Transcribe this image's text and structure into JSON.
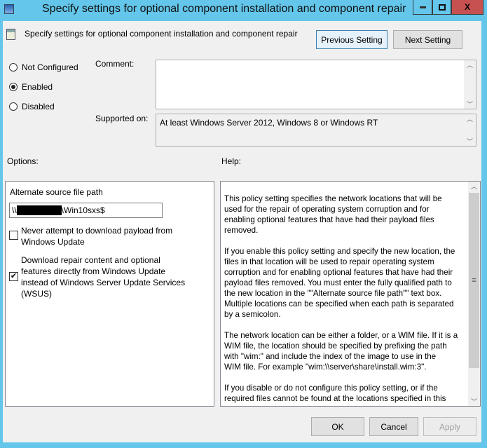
{
  "window": {
    "title": "Specify settings for optional component installation and component repair",
    "minimize": "‒",
    "maximize": "□",
    "close": "X",
    "frame_color": "#63c6ea",
    "close_color": "#c75050"
  },
  "header": {
    "setting_name": "Specify settings for optional component installation and component repair",
    "previous_label": "Previous Setting",
    "next_label": "Next Setting"
  },
  "state": {
    "options": [
      "Not Configured",
      "Enabled",
      "Disabled"
    ],
    "selected": "Enabled"
  },
  "comment": {
    "label": "Comment:",
    "value": ""
  },
  "supported": {
    "label": "Supported on:",
    "value": "At least Windows Server 2012, Windows 8 or Windows RT"
  },
  "options_label": "Options:",
  "help_label": "Help:",
  "options": {
    "path_label": "Alternate source file path",
    "path_prefix": "\\\\",
    "path_suffix": "\\Win10sxs$",
    "never_download": {
      "lines": [
        "Never attempt to download payload from",
        "Windows Update"
      ],
      "checked": false
    },
    "download_wu": {
      "lines": [
        "Download repair content and optional",
        "features directly from Windows Update",
        "instead of Windows Server Update Services",
        "(WSUS)"
      ],
      "checked": true
    }
  },
  "help": {
    "paragraphs": [
      [
        "This policy setting specifies the network locations that will be",
        "used for the repair of operating system corruption and for",
        "enabling optional features that have had their payload files",
        "removed."
      ],
      [
        "If you enable this policy setting and specify the new location, the",
        "files in that location will be used to repair operating system",
        "corruption and for enabling optional features that have had their",
        "payload files removed. You must enter the fully qualified path to",
        "the new location in the \"\"Alternate source file path\"\" text box.",
        "Multiple locations can be specified when each path is separated",
        "by a semicolon."
      ],
      [
        "The network location can be either a folder, or a WIM file. If it is a",
        "WIM file, the location should be specified by prefixing the path",
        "with \"wim:\" and include the index of the image to use in the",
        "WIM file. For example \"wim:\\\\server\\share\\install.wim:3\"."
      ],
      [
        "If you disable or do not configure this policy setting, or if the",
        "required files cannot be found at the locations specified in this"
      ]
    ]
  },
  "footer": {
    "ok": "OK",
    "cancel": "Cancel",
    "apply": "Apply"
  }
}
